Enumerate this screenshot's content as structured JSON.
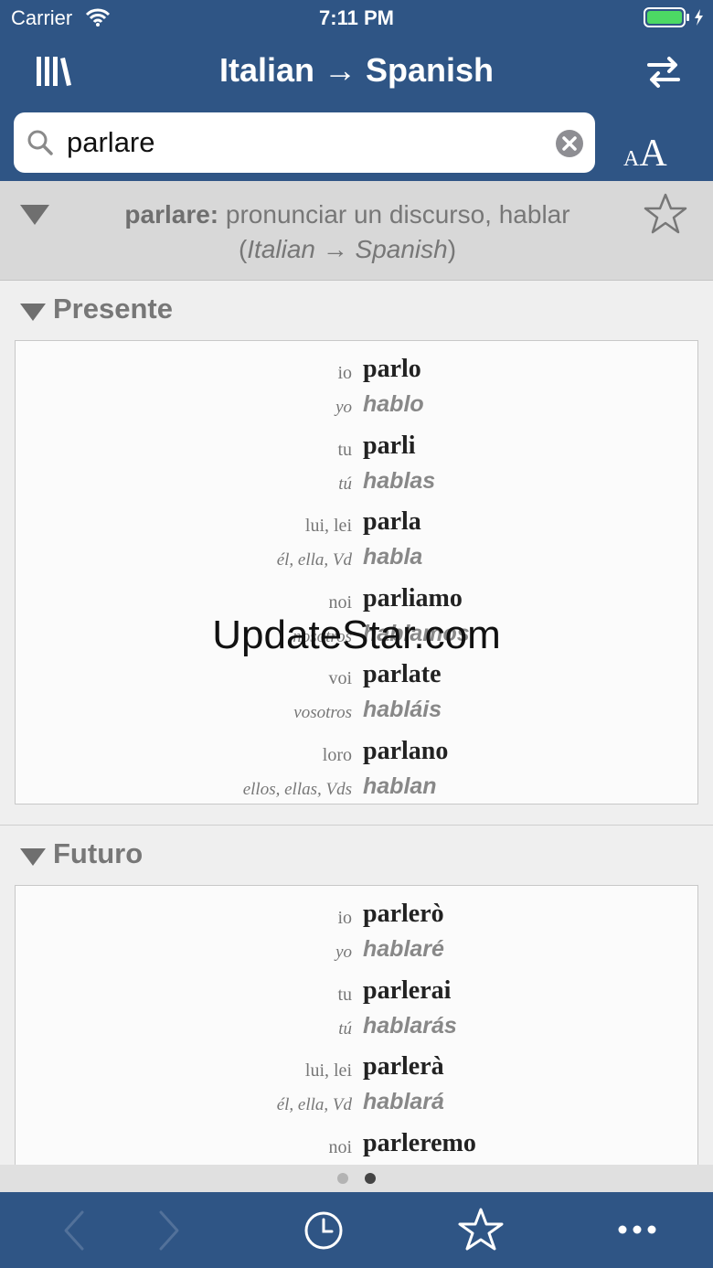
{
  "status_bar": {
    "carrier": "Carrier",
    "time": "7:11 PM"
  },
  "nav": {
    "title": "Italian → Spanish",
    "left_icon": "library-icon",
    "right_icon": "swap-direction-icon"
  },
  "search": {
    "value": "parlare",
    "placeholder": ""
  },
  "font_size_control": {
    "small": "A",
    "big": "A"
  },
  "entry": {
    "headword": "parlare:",
    "definition": "pronunciar un discurso, hablar",
    "direction_open": "(",
    "direction": "Italian → Spanish",
    "direction_close": ")"
  },
  "sections": [
    {
      "title": "Presente",
      "rows": [
        {
          "pron_it": "io",
          "verb_it": "parlo",
          "pron_es": "yo",
          "verb_es": "hablo"
        },
        {
          "pron_it": "tu",
          "verb_it": "parli",
          "pron_es": "tú",
          "verb_es": "hablas"
        },
        {
          "pron_it": "lui, lei",
          "verb_it": "parla",
          "pron_es": "él, ella, Vd",
          "verb_es": "habla"
        },
        {
          "pron_it": "noi",
          "verb_it": "parliamo",
          "pron_es": "nosotros",
          "verb_es": "hablamos"
        },
        {
          "pron_it": "voi",
          "verb_it": "parlate",
          "pron_es": "vosotros",
          "verb_es": "habláis"
        },
        {
          "pron_it": "loro",
          "verb_it": "parlano",
          "pron_es": "ellos, ellas, Vds",
          "verb_es": "hablan"
        }
      ]
    },
    {
      "title": "Futuro",
      "rows": [
        {
          "pron_it": "io",
          "verb_it": "parlerò",
          "pron_es": "yo",
          "verb_es": "hablaré"
        },
        {
          "pron_it": "tu",
          "verb_it": "parlerai",
          "pron_es": "tú",
          "verb_es": "hablarás"
        },
        {
          "pron_it": "lui, lei",
          "verb_it": "parlerà",
          "pron_es": "él, ella, Vd",
          "verb_es": "hablará"
        },
        {
          "pron_it": "noi",
          "verb_it": "parleremo",
          "pron_es": "",
          "verb_es": ""
        }
      ]
    }
  ],
  "watermark": "UpdateStar.com",
  "pager": {
    "page_count": 2,
    "current_page": 2
  },
  "toolbar": [
    "back-arrow-icon",
    "forward-arrow-icon",
    "history-clock-icon",
    "favorites-star-icon",
    "more-icon"
  ],
  "colors": {
    "nav_blue": "#2f5585",
    "header_gray": "#d8d8d8",
    "text_gray": "#777777"
  }
}
